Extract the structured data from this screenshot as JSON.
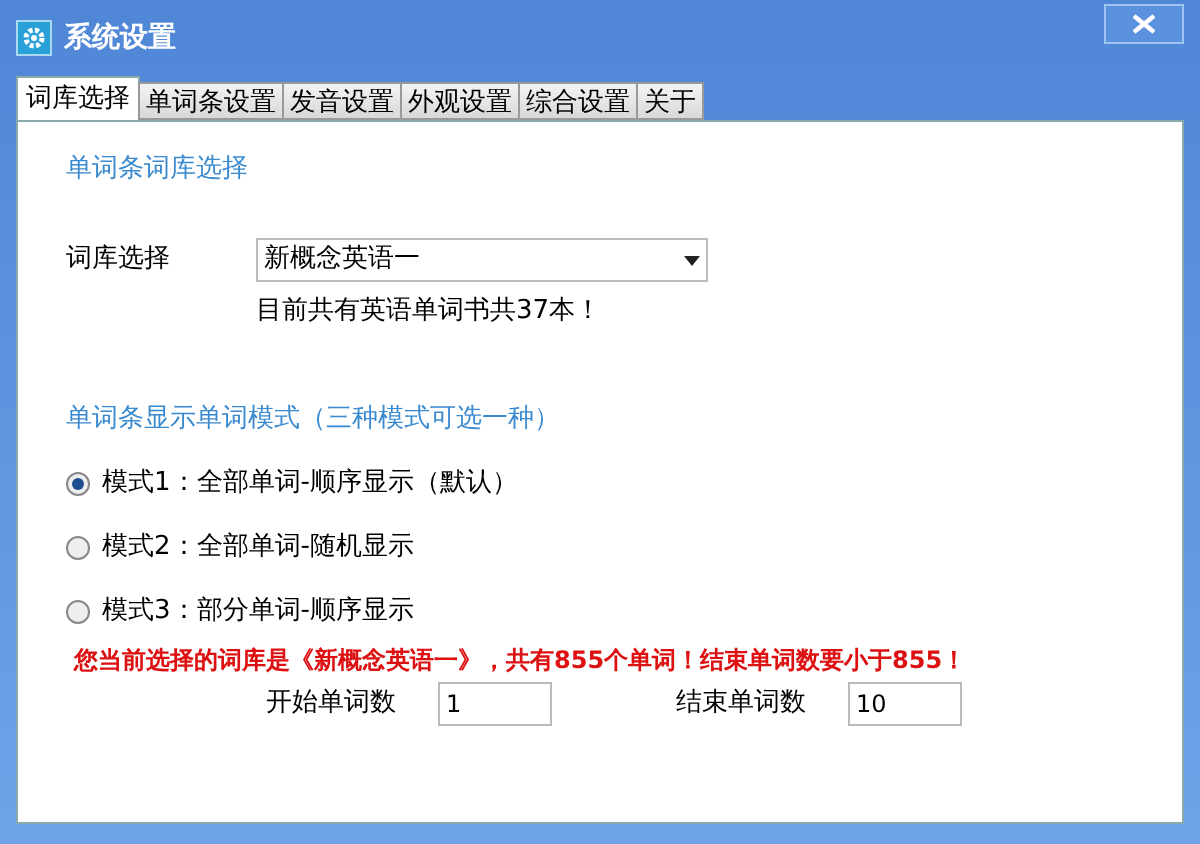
{
  "window": {
    "title": "系统设置"
  },
  "tabs": [
    {
      "label": "词库选择",
      "selected": true
    },
    {
      "label": "单词条设置",
      "selected": false
    },
    {
      "label": "发音设置",
      "selected": false
    },
    {
      "label": "外观设置",
      "selected": false
    },
    {
      "label": "综合设置",
      "selected": false
    },
    {
      "label": "关于",
      "selected": false
    }
  ],
  "library_section": {
    "title": "单词条词库选择",
    "label": "词库选择",
    "value": "新概念英语一",
    "note": "目前共有英语单词书共37本！"
  },
  "mode_section": {
    "title": "单词条显示单词模式（三种模式可选一种）",
    "options": [
      {
        "label": "模式1：全部单词-顺序显示（默认）",
        "selected": true
      },
      {
        "label": "模式2：全部单词-随机显示",
        "selected": false
      },
      {
        "label": "模式3：部分单词-顺序显示",
        "selected": false
      }
    ],
    "warning": "您当前选择的词库是《新概念英语一》，共有855个单词！结束单词数要小于855！",
    "fields": [
      {
        "label": "开始单词数",
        "value": "1"
      },
      {
        "label": "结束单词数",
        "value": "10"
      }
    ]
  }
}
